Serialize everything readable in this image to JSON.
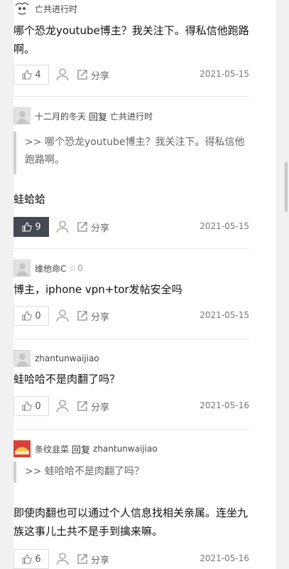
{
  "comments": [
    {
      "user": "亡共进行时",
      "text": "哪个恐龙youtube博主？我关注下。得私信他跑路啊。",
      "likes": "4",
      "share_label": "分享",
      "date": "2021-05-15"
    },
    {
      "user": "十二月的冬天",
      "reply_word": "回复",
      "reply_to": "亡共进行时",
      "quote": ">> 哪个恐龙youtube博主？我关注下。得私信他跑路啊。",
      "text": "蛙蛤蛤",
      "likes": "9",
      "share_label": "分享",
      "date": "2021-05-15"
    },
    {
      "user": "维他命C",
      "badge_icon": "☆",
      "badge_text": "0",
      "text": "博主，iphone vpn+tor发帖安全吗",
      "likes": "0",
      "share_label": "分享",
      "date": "2021-05-15"
    },
    {
      "user": "zhantunwaijiao",
      "text": "蛙哈哈不是肉翻了吗？",
      "likes": "0",
      "share_label": "分享",
      "date": "2021-05-16"
    },
    {
      "user": "条纹韭菜",
      "reply_word": "回复",
      "reply_to": "zhantunwaijiao",
      "quote": ">> 蛙哈哈不是肉翻了吗？",
      "text": "即使肉翻也可以通过个人信息找相关亲属。连坐九族这事儿土共不是手到擒来嘛。",
      "likes": "6",
      "share_label": "分享",
      "date": "2021-05-16"
    }
  ],
  "icons": {
    "like": "thumbs-up-icon",
    "user": "user-icon",
    "share": "share-icon"
  },
  "colors": {
    "liked_bg": "#434852",
    "quote_bar": "#cfcfcf",
    "date": "#777777"
  }
}
